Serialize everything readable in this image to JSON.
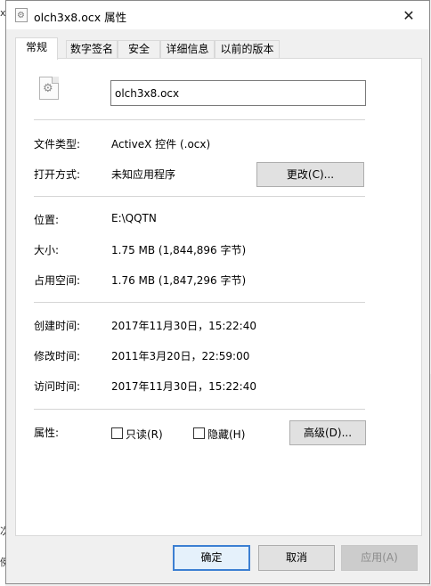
{
  "background": {
    "glyph_top": "x",
    "glyph_mid": "次",
    "glyph_low": "例"
  },
  "window": {
    "title": "olch3x8.ocx 属性",
    "close_glyph": "✕"
  },
  "tabs": [
    {
      "label": "常规",
      "active": true
    },
    {
      "label": "数字签名",
      "active": false
    },
    {
      "label": "安全",
      "active": false
    },
    {
      "label": "详细信息",
      "active": false
    },
    {
      "label": "以前的版本",
      "active": false
    }
  ],
  "general": {
    "file_name": "olch3x8.ocx",
    "file_type_label": "文件类型:",
    "file_type_value": "ActiveX 控件 (.ocx)",
    "opens_with_label": "打开方式:",
    "opens_with_value": "未知应用程序",
    "change_button": "更改(C)...",
    "location_label": "位置:",
    "location_value": "E:\\QQTN",
    "size_label": "大小:",
    "size_value": "1.75 MB (1,844,896 字节)",
    "size_on_disk_label": "占用空间:",
    "size_on_disk_value": "1.76 MB (1,847,296 字节)",
    "created_label": "创建时间:",
    "created_value": "2017年11月30日，15:22:40",
    "modified_label": "修改时间:",
    "modified_value": "2011年3月20日，22:59:00",
    "accessed_label": "访问时间:",
    "accessed_value": "2017年11月30日，15:22:40",
    "attributes_label": "属性:",
    "readonly_label": "只读(R)",
    "readonly_checked": false,
    "hidden_label": "隐藏(H)",
    "hidden_checked": false,
    "advanced_button": "高级(D)..."
  },
  "footer": {
    "ok_button": "确定",
    "cancel_button": "取消",
    "apply_button": "应用(A)"
  },
  "colors": {
    "focus_border": "#3c7fd2",
    "panel_background": "#ffffff",
    "dialog_background": "#f0f0f0"
  }
}
